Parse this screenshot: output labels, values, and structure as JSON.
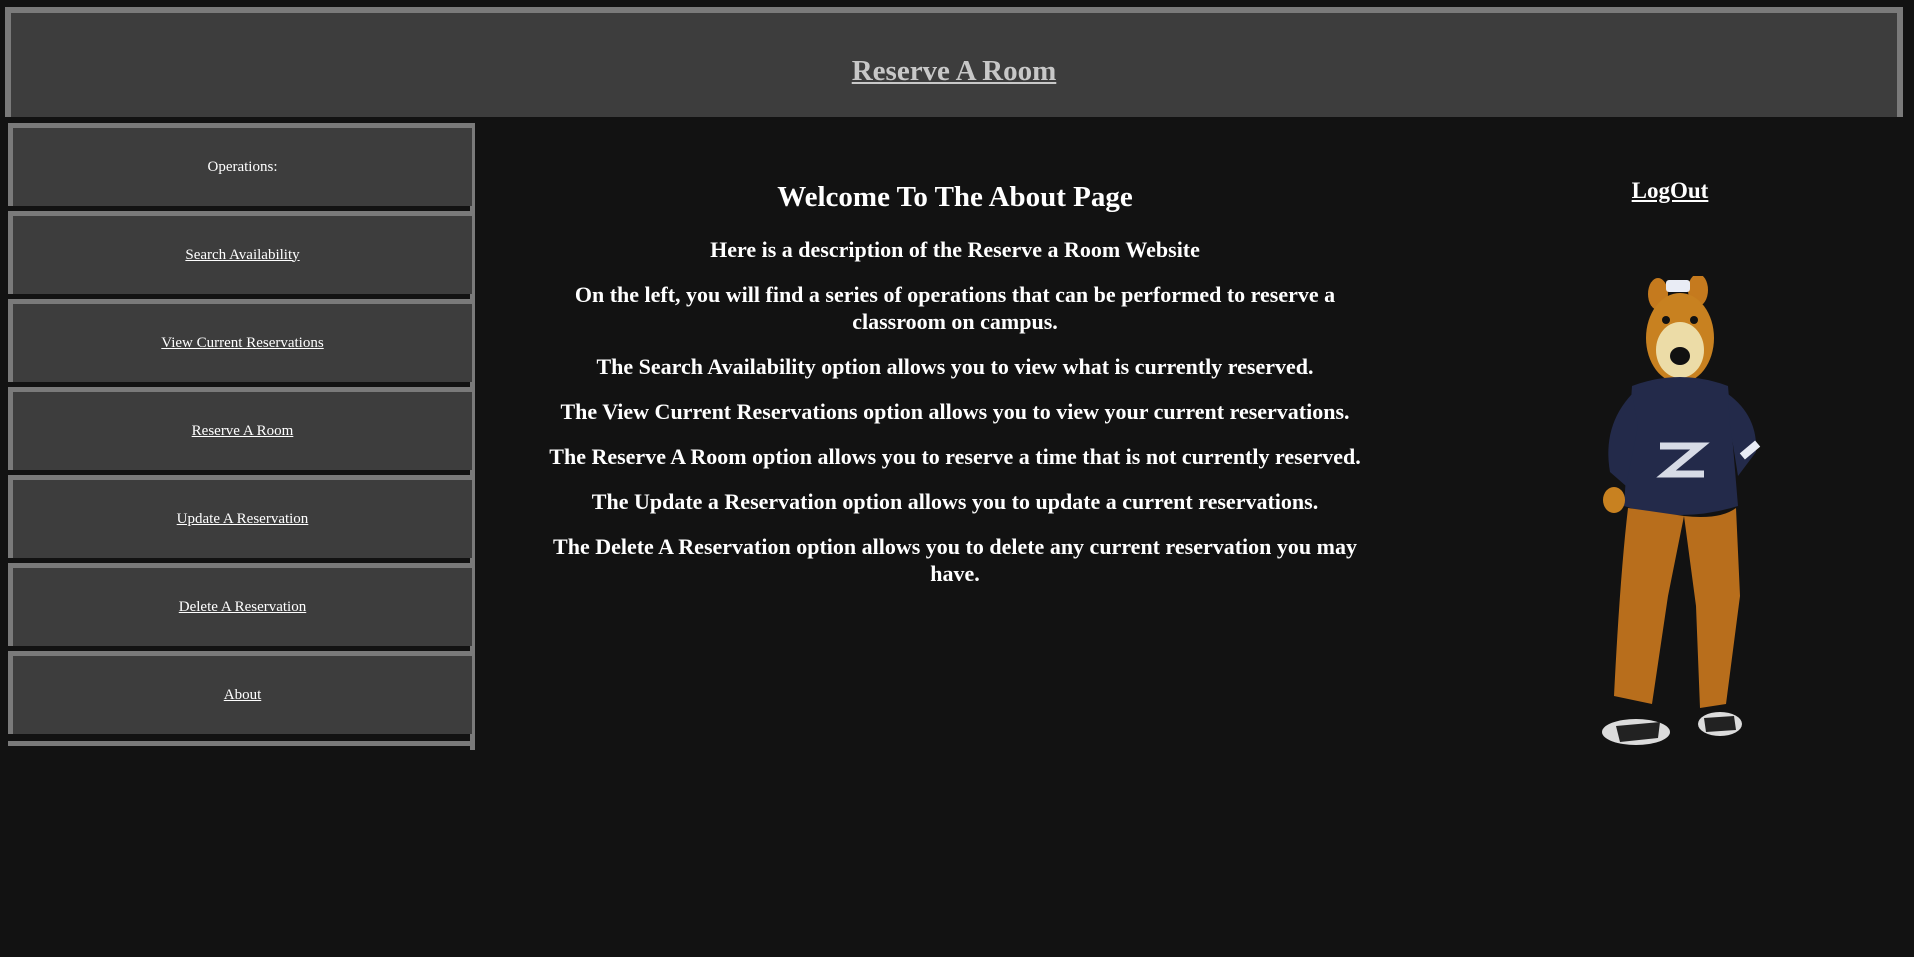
{
  "header": {
    "title": "Reserve A Room"
  },
  "sidebar": {
    "heading": "Operations:",
    "items": [
      {
        "label": "Search Availability"
      },
      {
        "label": "View Current Reservations"
      },
      {
        "label": "Reserve A Room"
      },
      {
        "label": "Update A Reservation"
      },
      {
        "label": "Delete A Reservation"
      },
      {
        "label": "About"
      }
    ]
  },
  "main": {
    "title": "Welcome To The About Page",
    "paragraphs": [
      "Here is a description of the Reserve a Room Website",
      "On the left, you will find a series of operations that can be performed to reserve a classroom on campus.",
      "The Search Availability option allows you to view what is currently reserved.",
      "The View Current Reservations option allows you to view your current reservations.",
      "The Reserve A Room option allows you to reserve a time that is not currently reserved.",
      "The Update a Reservation option allows you to update a current reservations.",
      "The Delete A Reservation option allows you to delete any current reservation you may have."
    ]
  },
  "logout": {
    "label": "LogOut"
  },
  "mascot": {
    "icon": "mascot-zippy-image"
  },
  "colors": {
    "background": "#121212",
    "panel": "#3d3d3d",
    "border": "#7a7a7a",
    "header_text": "#c8c8c8",
    "text": "#ffffff"
  }
}
